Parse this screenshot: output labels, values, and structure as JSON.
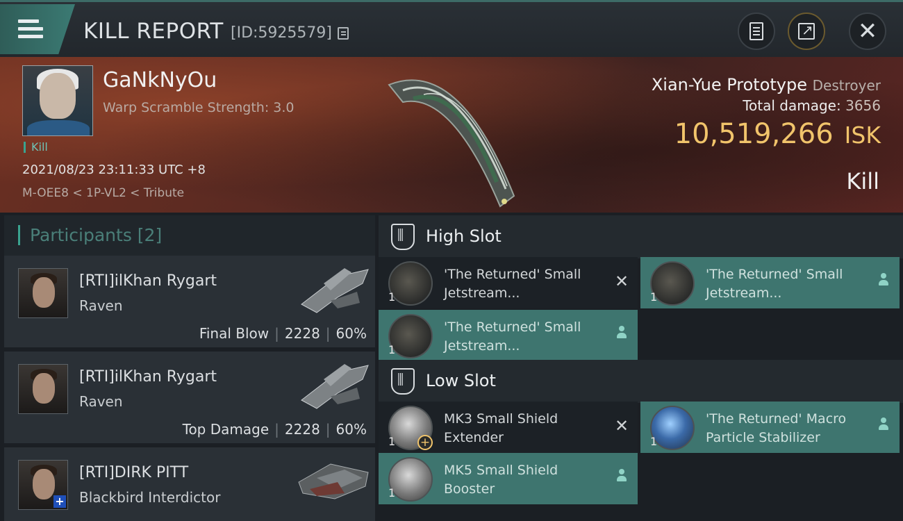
{
  "header": {
    "title": "KILL REPORT",
    "id_label": "[ID:5925579]"
  },
  "victim": {
    "name": "GaNkNyOu",
    "warp_scramble": "Warp Scramble Strength: 3.0",
    "tag": "Kill",
    "datetime": "2021/08/23 23:11:33 UTC +8",
    "location": "M-OEE8 < 1P-VL2 < Tribute",
    "ship_name": "Xian-Yue Prototype",
    "ship_class": "Destroyer",
    "total_damage_label": "Total damage:",
    "total_damage": "3656",
    "isk_value": "10,519,266",
    "isk_unit": "ISK",
    "result": "Kill"
  },
  "participants": {
    "title": "Participants [2]",
    "rows": [
      {
        "name": "[RTI]ilKhan Rygart",
        "ship": "Raven",
        "role": "Final Blow",
        "damage": "2228",
        "percent": "60%"
      },
      {
        "name": "[RTI]ilKhan Rygart",
        "ship": "Raven",
        "role": "Top Damage",
        "damage": "2228",
        "percent": "60%"
      },
      {
        "name": "[RTI]DIRK PITT",
        "ship": "Blackbird Interdictor"
      }
    ]
  },
  "slots": {
    "high": {
      "label": "High Slot",
      "items": [
        {
          "name": "'The Returned' Small Jetstream...",
          "qty": "1",
          "state": "destroyed"
        },
        {
          "name": "'The Returned' Small Jetstream...",
          "qty": "1",
          "state": "dropped"
        },
        {
          "name": "'The Returned' Small Jetstream...",
          "qty": "1",
          "state": "dropped"
        }
      ]
    },
    "low": {
      "label": "Low Slot",
      "items": [
        {
          "name": "MK3 Small Shield Extender",
          "qty": "1",
          "state": "destroyed"
        },
        {
          "name": "'The Returned' Macro Particle Stabilizer",
          "qty": "1",
          "state": "dropped"
        },
        {
          "name": "MK5 Small Shield Booster",
          "qty": "1",
          "state": "dropped"
        }
      ]
    }
  },
  "colors": {
    "accent_teal": "#3e756f",
    "isk_gold": "#f1c46b",
    "hero_red": "#6b2f22"
  },
  "icons": {
    "menu": "hamburger-icon",
    "copy": "copy-icon",
    "document": "document-icon",
    "share": "share-icon",
    "close": "close-icon",
    "slot": "slot-rack-icon",
    "destroyed": "x-icon",
    "dropped": "person-icon"
  }
}
